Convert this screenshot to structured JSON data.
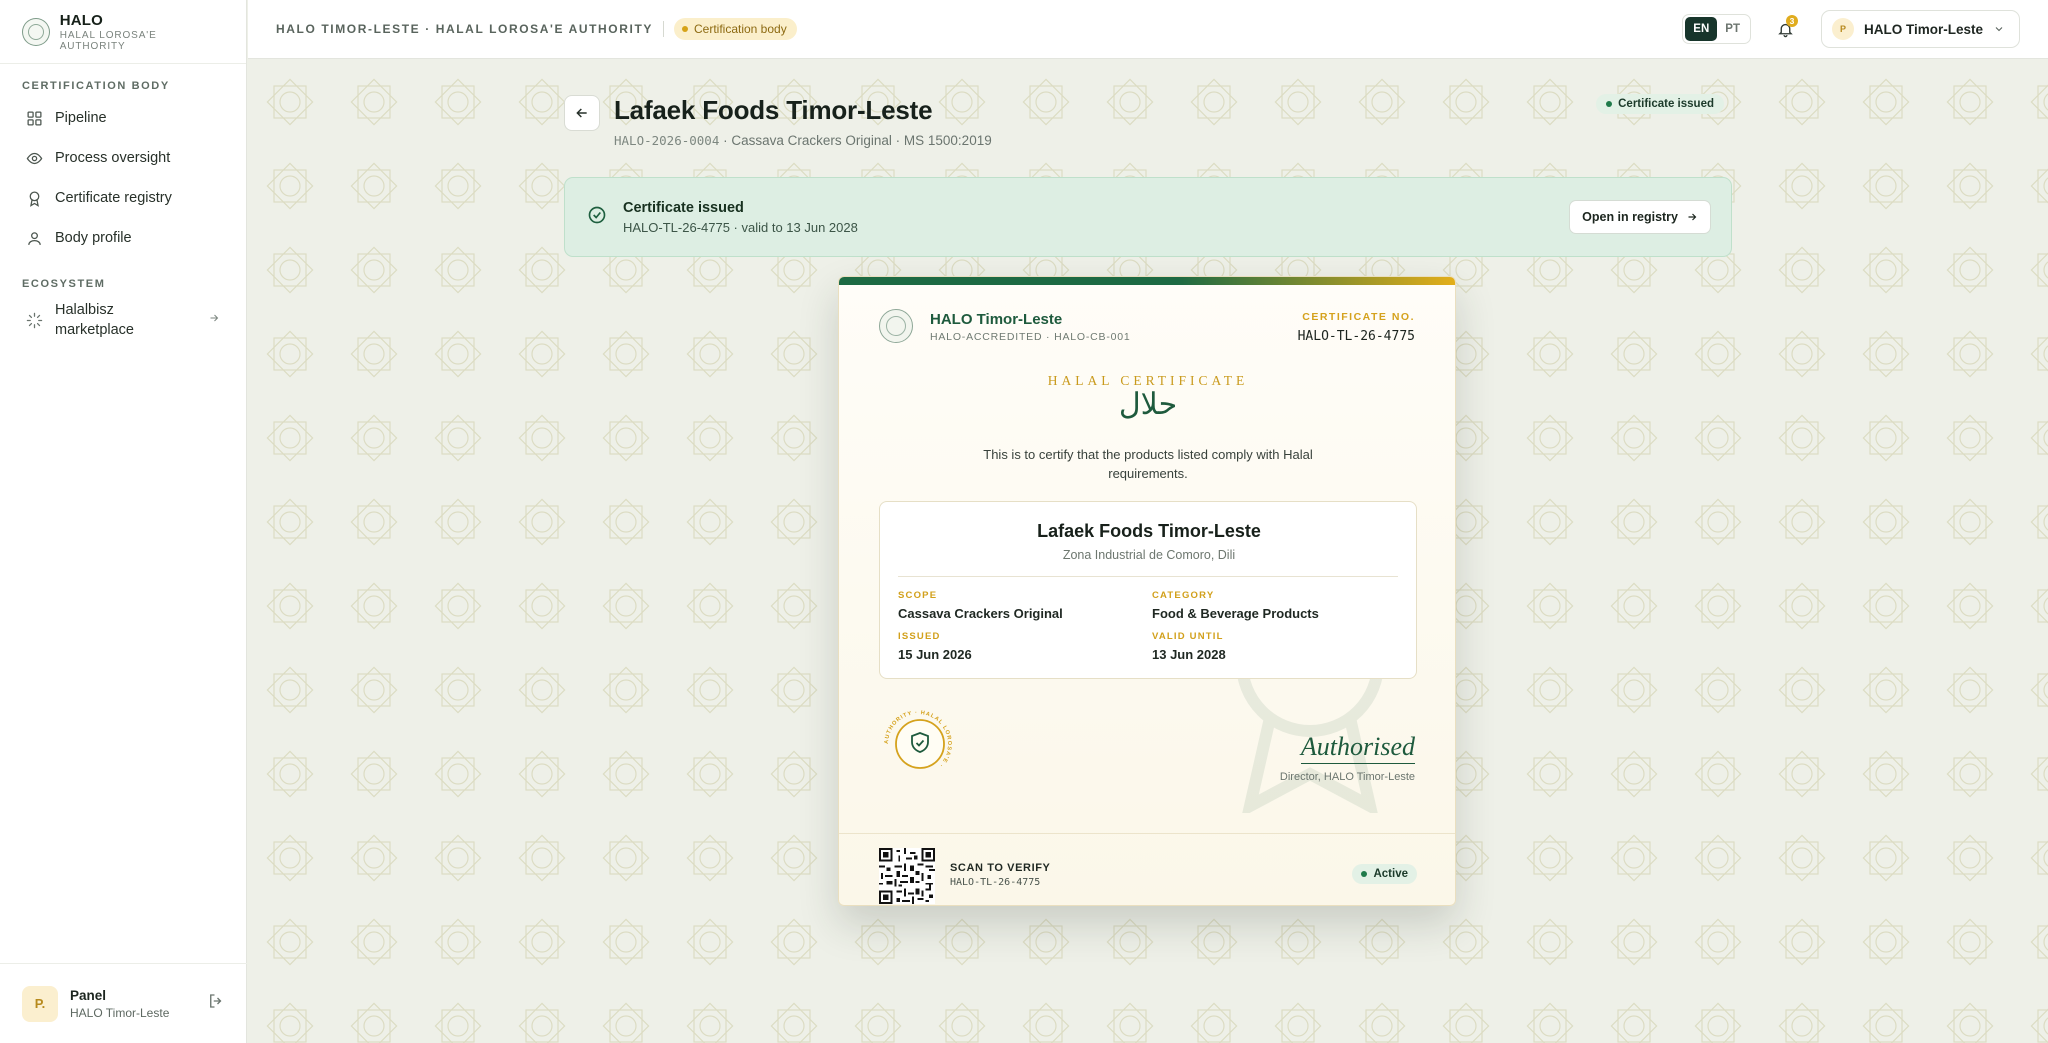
{
  "brand": {
    "name": "HALO",
    "subtitle": "HALAL LOROSA'E AUTHORITY"
  },
  "sidebar": {
    "section1": "CERTIFICATION BODY",
    "items": [
      {
        "label": "Pipeline",
        "icon": "grid-icon"
      },
      {
        "label": "Process oversight",
        "icon": "eye-icon"
      },
      {
        "label": "Certificate registry",
        "icon": "award-icon"
      },
      {
        "label": "Body profile",
        "icon": "user-icon"
      }
    ],
    "section2": "ECOSYSTEM",
    "ecosystem": {
      "label": "Halalbisz marketplace",
      "icon": "spinner-icon"
    },
    "footer": {
      "avatar": "P.",
      "name": "Panel",
      "org": "HALO Timor-Leste"
    }
  },
  "topbar": {
    "breadcrumb": "HALO TIMOR-LESTE · HALAL LOROSA'E AUTHORITY",
    "role_pill": "Certification body",
    "lang": [
      "EN",
      "PT"
    ],
    "notifications": "3",
    "account": {
      "avatar": "P",
      "name": "HALO Timor-Leste"
    }
  },
  "page": {
    "title": "Lafaek Foods Timor-Leste",
    "case_id": "HALO-2026-0004",
    "subtitle_rest": " · Cassava Crackers Original · MS 1500:2019",
    "status": "Certificate issued"
  },
  "banner": {
    "title": "Certificate issued",
    "detail": "HALO-TL-26-4775 · valid to 13 Jun 2028",
    "button": "Open in registry"
  },
  "certificate": {
    "org": "HALO Timor-Leste",
    "org_sub": "HALO-ACCREDITED · HALO-CB-001",
    "no_label": "CERTIFICATE NO.",
    "number": "HALO-TL-26-4775",
    "heading": "HALAL CERTIFICATE",
    "arabic": "حلال",
    "statement": "This is to certify that the products listed comply with Halal requirements.",
    "company": "Lafaek Foods Timor-Leste",
    "address": "Zona Industrial de Comoro, Dili",
    "fields": {
      "scope_label": "SCOPE",
      "scope": "Cassava Crackers Original",
      "category_label": "CATEGORY",
      "category": "Food & Beverage Products",
      "issued_label": "ISSUED",
      "issued": "15 Jun 2026",
      "valid_label": "VALID UNTIL",
      "valid": "13 Jun 2028"
    },
    "stamp_text": "AUTHORITY · HALAL LOROSA'E ·",
    "signature": "Authorised",
    "signatory": "Director, HALO Timor-Leste",
    "scan_label": "SCAN TO VERIFY",
    "scan_id": "HALO-TL-26-4775",
    "state": "Active"
  },
  "colors": {
    "primary": "#1e5a3d",
    "gold": "#d5a21d",
    "ink": "#17352b"
  }
}
